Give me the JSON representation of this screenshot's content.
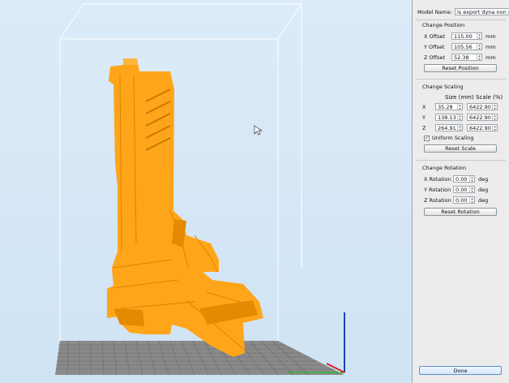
{
  "model_name": {
    "label": "Model Name:",
    "value": "is export dyna non smooth"
  },
  "position": {
    "title": "Change Position",
    "unit": "mm",
    "x": {
      "label": "X Offset",
      "value": "115.00"
    },
    "y": {
      "label": "Y Offset",
      "value": "105.56"
    },
    "z": {
      "label": "Z Offset",
      "value": "52.38"
    },
    "reset_label": "Reset Position"
  },
  "scaling": {
    "title": "Change Scaling",
    "size_header": "Size (mm)",
    "scale_header": "Scale (%)",
    "x": {
      "label": "X",
      "size": "35.28",
      "scale": "6422.90"
    },
    "y": {
      "label": "Y",
      "size": "138.13",
      "scale": "6422.90"
    },
    "z": {
      "label": "Z",
      "size": "264.91",
      "scale": "6422.90"
    },
    "uniform_label": "Uniform Scaling",
    "uniform_checked": true,
    "reset_label": "Reset Scale"
  },
  "rotation": {
    "title": "Change Rotation",
    "unit": "deg",
    "x": {
      "label": "X Rotation",
      "value": "0.00"
    },
    "y": {
      "label": "Y Rotation",
      "value": "0.00"
    },
    "z": {
      "label": "Z Rotation",
      "value": "0.00"
    },
    "reset_label": "Reset Rotation"
  },
  "done_label": "Done",
  "colors": {
    "model": "#ffa51a",
    "model_shade": "#e58a00",
    "bed": "#7a7a7a",
    "panel": "#ececec"
  }
}
